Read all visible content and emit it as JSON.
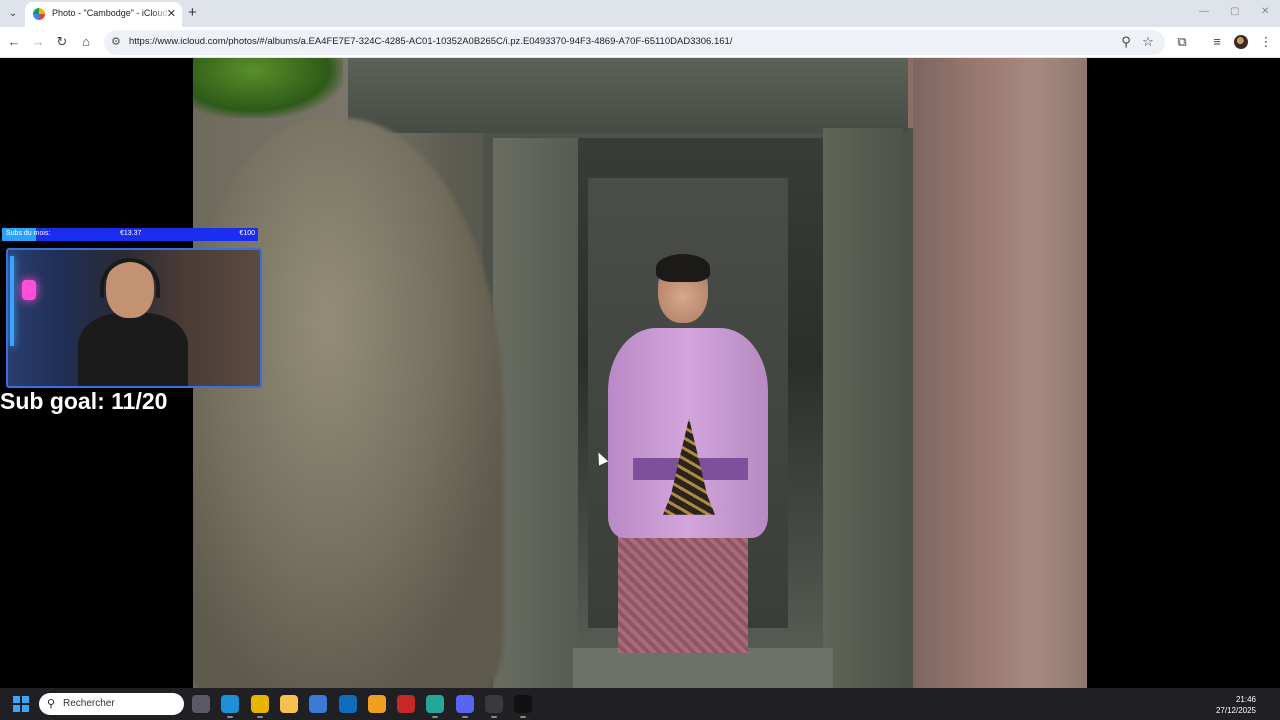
{
  "browser": {
    "tab_title": "Photo - \"Cambodge\" - iCloud Photos",
    "url": "https://www.icloud.com/photos/#/albums/a.EA4FE7E7-324C-4285-AC01-10352A0B265C/i.pz.E0493370-94F3-4869-A70F-65110DAD3306.161/",
    "icons": {
      "tab_menu": "chevron-down-icon",
      "close": "close-icon",
      "new_tab": "plus-icon",
      "back": "arrow-left-icon",
      "forward": "arrow-right-icon",
      "reload": "reload-icon",
      "home": "home-icon",
      "site_info": "tune-icon",
      "zoom": "zoom-icon",
      "bookmark": "star-icon",
      "extensions": "puzzle-icon",
      "media": "media-control-icon",
      "menu": "kebab-menu-icon"
    },
    "glyphs": {
      "tab_menu": "⌄",
      "close": "✕",
      "new_tab": "+",
      "back": "←",
      "forward": "→",
      "reload": "↻",
      "home": "⌂",
      "site_info": "⚙",
      "zoom": "⚲",
      "bookmark": "☆",
      "extensions": "⧉",
      "media": "≡",
      "menu": "⋮",
      "minimize": "—",
      "maximize": "▢",
      "window_close": "✕"
    }
  },
  "overlay": {
    "goal_label": "Subs du mois:",
    "goal_current": "€13.37",
    "goal_target": "€100",
    "goal_progress": 0.1337,
    "sub_goal": "Sub goal: 11/20"
  },
  "taskbar": {
    "search_placeholder": "Rechercher",
    "search_glyph": "⚲",
    "time": "21:46",
    "date": "27/12/2025",
    "apps": [
      {
        "name": "task-view-icon",
        "color": "#5a5a66"
      },
      {
        "name": "edge-icon",
        "color": "#1e90d6"
      },
      {
        "name": "chrome-icon",
        "color": "#e8b400"
      },
      {
        "name": "file-explorer-icon",
        "color": "#f2c14e"
      },
      {
        "name": "store-icon",
        "color": "#3a7bd5"
      },
      {
        "name": "outlook-icon",
        "color": "#0f6cbd"
      },
      {
        "name": "brave-icon",
        "color": "#f0a020"
      },
      {
        "name": "voice-app-icon",
        "color": "#c62828"
      },
      {
        "name": "notes-app-icon",
        "color": "#26a69a"
      },
      {
        "name": "discord-icon",
        "color": "#5865f2"
      },
      {
        "name": "obs-icon",
        "color": "#3a3a3a"
      },
      {
        "name": "audio-app-icon",
        "color": "#111111"
      }
    ]
  }
}
